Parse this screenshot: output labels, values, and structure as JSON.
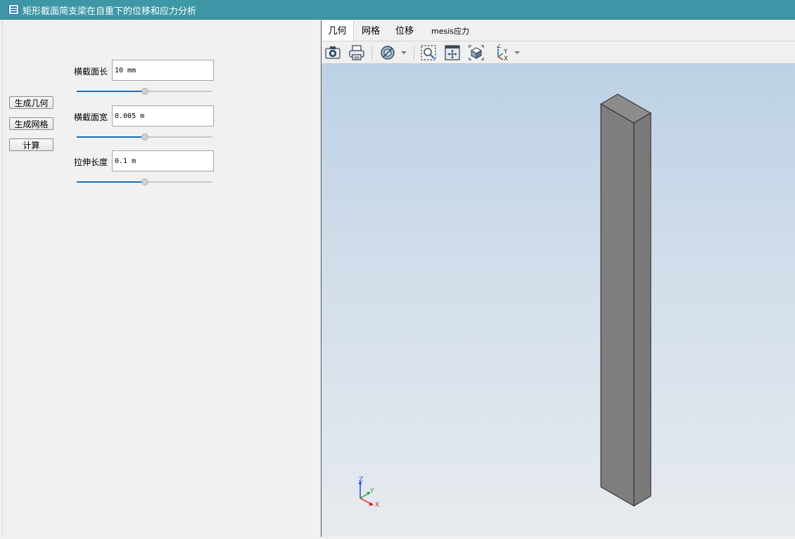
{
  "window": {
    "title": "矩形截面简支梁在自重下的位移和应力分析"
  },
  "buttons": {
    "geometry": "生成几何",
    "mesh": "生成网格",
    "compute": "计算"
  },
  "fields": [
    {
      "label": "横截面长",
      "value": "10 mm",
      "slider_fraction": 0.5
    },
    {
      "label": "横截面宽",
      "value": "0.005 m",
      "slider_fraction": 0.5
    },
    {
      "label": "拉伸长度",
      "value": "0.1 m",
      "slider_fraction": 0.5
    }
  ],
  "tabs": [
    {
      "label": "几何",
      "active": true
    },
    {
      "label": "网格",
      "active": false
    },
    {
      "label": "位移",
      "active": false
    },
    {
      "label": "mesis应力",
      "active": false
    }
  ],
  "toolbar": [
    "camera-icon",
    "print-icon",
    "display-mode-icon",
    "zoom-box-icon",
    "zoom-fit-icon",
    "view-iso-icon",
    "axes-orientation-icon"
  ],
  "triad": {
    "x": "X",
    "y": "Y",
    "z": "Z"
  },
  "colors": {
    "titlebar": "#3d97a6",
    "slider_fill": "#1a6fb5",
    "beam": "#7f7f7f"
  }
}
